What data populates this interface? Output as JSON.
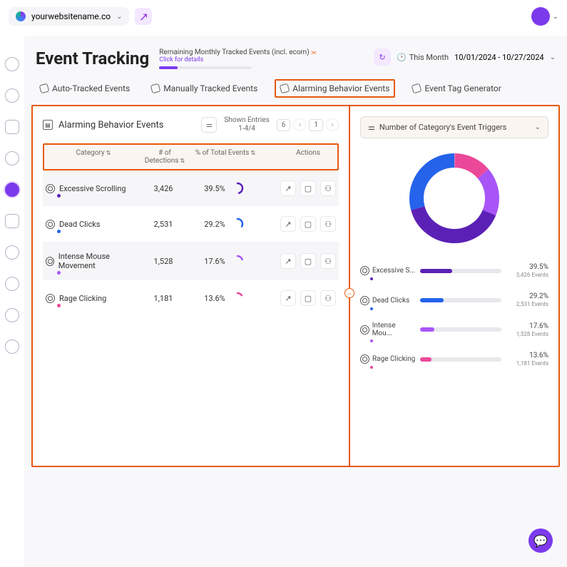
{
  "site": "yourwebsitename.co",
  "page_title": "Event Tracking",
  "remaining_label": "Remaining Monthly Tracked Events (incl. ecom)",
  "click_details": "Click for details",
  "period_label": "This Month",
  "date_range": "10/01/2024 - 10/27/2024",
  "tabs": {
    "auto": "Auto-Tracked Events",
    "manual": "Manually Tracked Events",
    "alarming": "Alarming Behavior Events",
    "generator": "Event Tag Generator"
  },
  "panel_title": "Alarming Behavior Events",
  "shown_entries_label": "Shown Entries",
  "shown_entries_val": "1-4/4",
  "page_size": "6",
  "page_num": "1",
  "columns": {
    "category": "Category",
    "detections": "# of Detections",
    "pct": "% of Total Events",
    "actions": "Actions"
  },
  "rows": [
    {
      "name": "Excessive Scrolling",
      "short": "Excessive S...",
      "det": "3,426",
      "pct": "39.5%",
      "events": "3,426 Events",
      "color": "#5b21b6",
      "dot": "#5b21b6"
    },
    {
      "name": "Dead Clicks",
      "short": "Dead Clicks",
      "det": "2,531",
      "pct": "29.2%",
      "events": "2,531 Events",
      "color": "#2563eb",
      "dot": "#2563eb"
    },
    {
      "name": "Intense Mouse Movement",
      "short": "Intense Mou...",
      "det": "1,528",
      "pct": "17.6%",
      "events": "1,528 Events",
      "color": "#a855f7",
      "dot": "#a855f7"
    },
    {
      "name": "Rage Clicking",
      "short": "Rage Clicking",
      "det": "1,181",
      "pct": "13.6%",
      "events": "1,181 Events",
      "color": "#ec4899",
      "dot": "#ec4899"
    }
  ],
  "chart_title": "Number of Category's Event Triggers",
  "chart_data": {
    "type": "pie",
    "title": "Number of Category's Event Triggers",
    "series": [
      {
        "name": "Excessive Scrolling",
        "value": 3426,
        "pct": 39.5,
        "color": "#5b21b6"
      },
      {
        "name": "Dead Clicks",
        "value": 2531,
        "pct": 29.2,
        "color": "#2563eb"
      },
      {
        "name": "Intense Mouse Movement",
        "value": 1528,
        "pct": 17.6,
        "color": "#a855f7"
      },
      {
        "name": "Rage Clicking",
        "value": 1181,
        "pct": 13.6,
        "color": "#ec4899"
      }
    ]
  }
}
